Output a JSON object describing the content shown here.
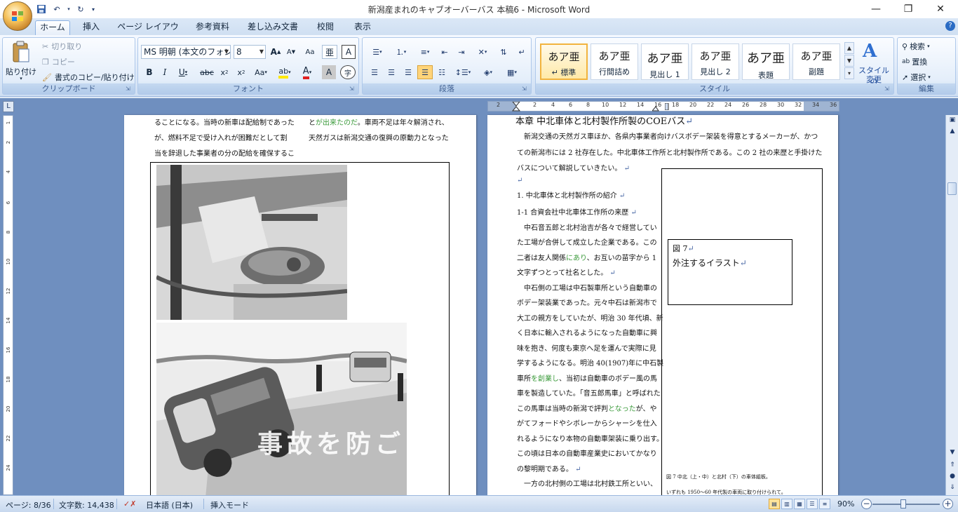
{
  "window": {
    "title": "新潟産まれのキャブオーバーバス 本稿6 - Microsoft Word",
    "minimize": "—",
    "maximize": "❐",
    "close": "✕"
  },
  "ribbon_tabs": [
    "ホーム",
    "挿入",
    "ページ レイアウト",
    "参考資料",
    "差し込み文書",
    "校閲",
    "表示"
  ],
  "clipboard": {
    "paste": "貼り付け",
    "cut": "切り取り",
    "copy": "コピー",
    "format_painter": "書式のコピー/貼り付け",
    "label": "クリップボード"
  },
  "font": {
    "name": "MS 明朝 (本文のフォン",
    "size": "8",
    "label": "フォント"
  },
  "paragraph": {
    "label": "段落"
  },
  "styles": {
    "items": [
      {
        "sample": "あア亜",
        "name": "↵ 標準"
      },
      {
        "sample": "あア亜",
        "name": "行間詰め"
      },
      {
        "sample": "あア亜",
        "name": "見出し 1"
      },
      {
        "sample": "あア亜",
        "name": "見出し 2"
      },
      {
        "sample": "あア亜",
        "name": "表題"
      },
      {
        "sample": "あア亜",
        "name": "副題"
      }
    ],
    "change_styles_line1": "スタイルの",
    "change_styles_line2": "変更",
    "label": "スタイル"
  },
  "editing": {
    "find": "検索",
    "replace": "置換",
    "select": "選択",
    "label": "編集"
  },
  "ruler": {
    "corner": "L",
    "ticks": [
      "2",
      "2",
      "4",
      "6",
      "8",
      "10",
      "12",
      "14",
      "16",
      "18",
      "20",
      "22",
      "24",
      "26",
      "28",
      "30",
      "32",
      "34",
      "36"
    ],
    "vticks": [
      "1",
      "2",
      "4",
      "6",
      "8",
      "10",
      "12",
      "14",
      "16",
      "18",
      "20",
      "22",
      "24"
    ]
  },
  "left_page": {
    "lines": [
      "ることになる。当時の新車は配給制であった",
      "が、燃料不足で受け入れが困難だとして割",
      "当を辞退した事業者の分の配給を確保するこ"
    ],
    "right_col": [
      {
        "pre": "と",
        "green": "が出来たのだ",
        "post": "。車両不足は年々解消され、"
      },
      {
        "pre": "天然ガスは新潟交通の復興の原動力となった",
        "green": "",
        "post": ""
      }
    ],
    "photo_caption_text": "事故を防ごう"
  },
  "right_page": {
    "heading": "本章  中北車体と北村製作所製のCOEバス",
    "intro": [
      "新潟交通の天然ガス車ほか、各県内事業者向けバスボデー架装を得意とするメーカーが、かつ",
      "ての新潟市には 2 社存在した。中北車体工作所と北村製作所である。この 2 社の来歴と手掛けた",
      "バスについて解説していきたい。"
    ],
    "section1": "1. 中北車体と北村製作所の紹介",
    "section1_1": "1-1 合資会社中北車体工作所の来歴",
    "body": [
      {
        "t": "中石音五郎と北村治吉が各々で経営してい",
        "indent": true
      },
      {
        "t": "た工場が合併して成立した企業である。この"
      },
      {
        "t": "二者は友人関係",
        "g": "にあり",
        "t2": "、お互いの苗字から 1"
      },
      {
        "t": "文字ずつとって社名とした。"
      },
      {
        "t": "中石側の工場は中石製車所という自動車の",
        "indent": true
      },
      {
        "t": "ボデー架装業であった。元々中石は新潟市で"
      },
      {
        "t": "大工の親方をしていたが、明治 30 年代頃、新"
      },
      {
        "t": "く日本に輸入されるようになった自動車に興"
      },
      {
        "t": "味を抱き、何度も東京へ足を運んで実際に見"
      },
      {
        "t": "学するようになる。明治 40(1907)年に中石製"
      },
      {
        "t": "車所",
        "g": "を創業し",
        "t2": "、当初は自動車のボデー風の馬"
      },
      {
        "t": "車を製造していた。「音五郎馬車」と呼ばれた"
      },
      {
        "t": "この馬車は当時の新潟で評判",
        "g": "となった",
        "t2": "が、や"
      },
      {
        "t": "がてフォードやシボレーからシャーシを仕入"
      },
      {
        "t": "れるようになり本物の自動車架装に乗り出す。"
      },
      {
        "t": "この頃は日本の自動車産業史においてかなり"
      },
      {
        "t": "の黎明期である。"
      },
      {
        "t": "一方の北村側の工場は北村鉄工所といい、",
        "indent": true
      }
    ],
    "figure_label": "図 7",
    "figure_text": "外注するイラスト",
    "figure_caption1": "図 7 中北（上・中）と北村（下）の車体組板。",
    "figure_caption2": "いずれも 1950～60 年代製の車両に取り付けられて。"
  },
  "status": {
    "page": "ページ: 8/36",
    "words": "文字数: 14,438",
    "language": "日本語 (日本)",
    "mode": "挿入モード",
    "zoom": "90%"
  }
}
